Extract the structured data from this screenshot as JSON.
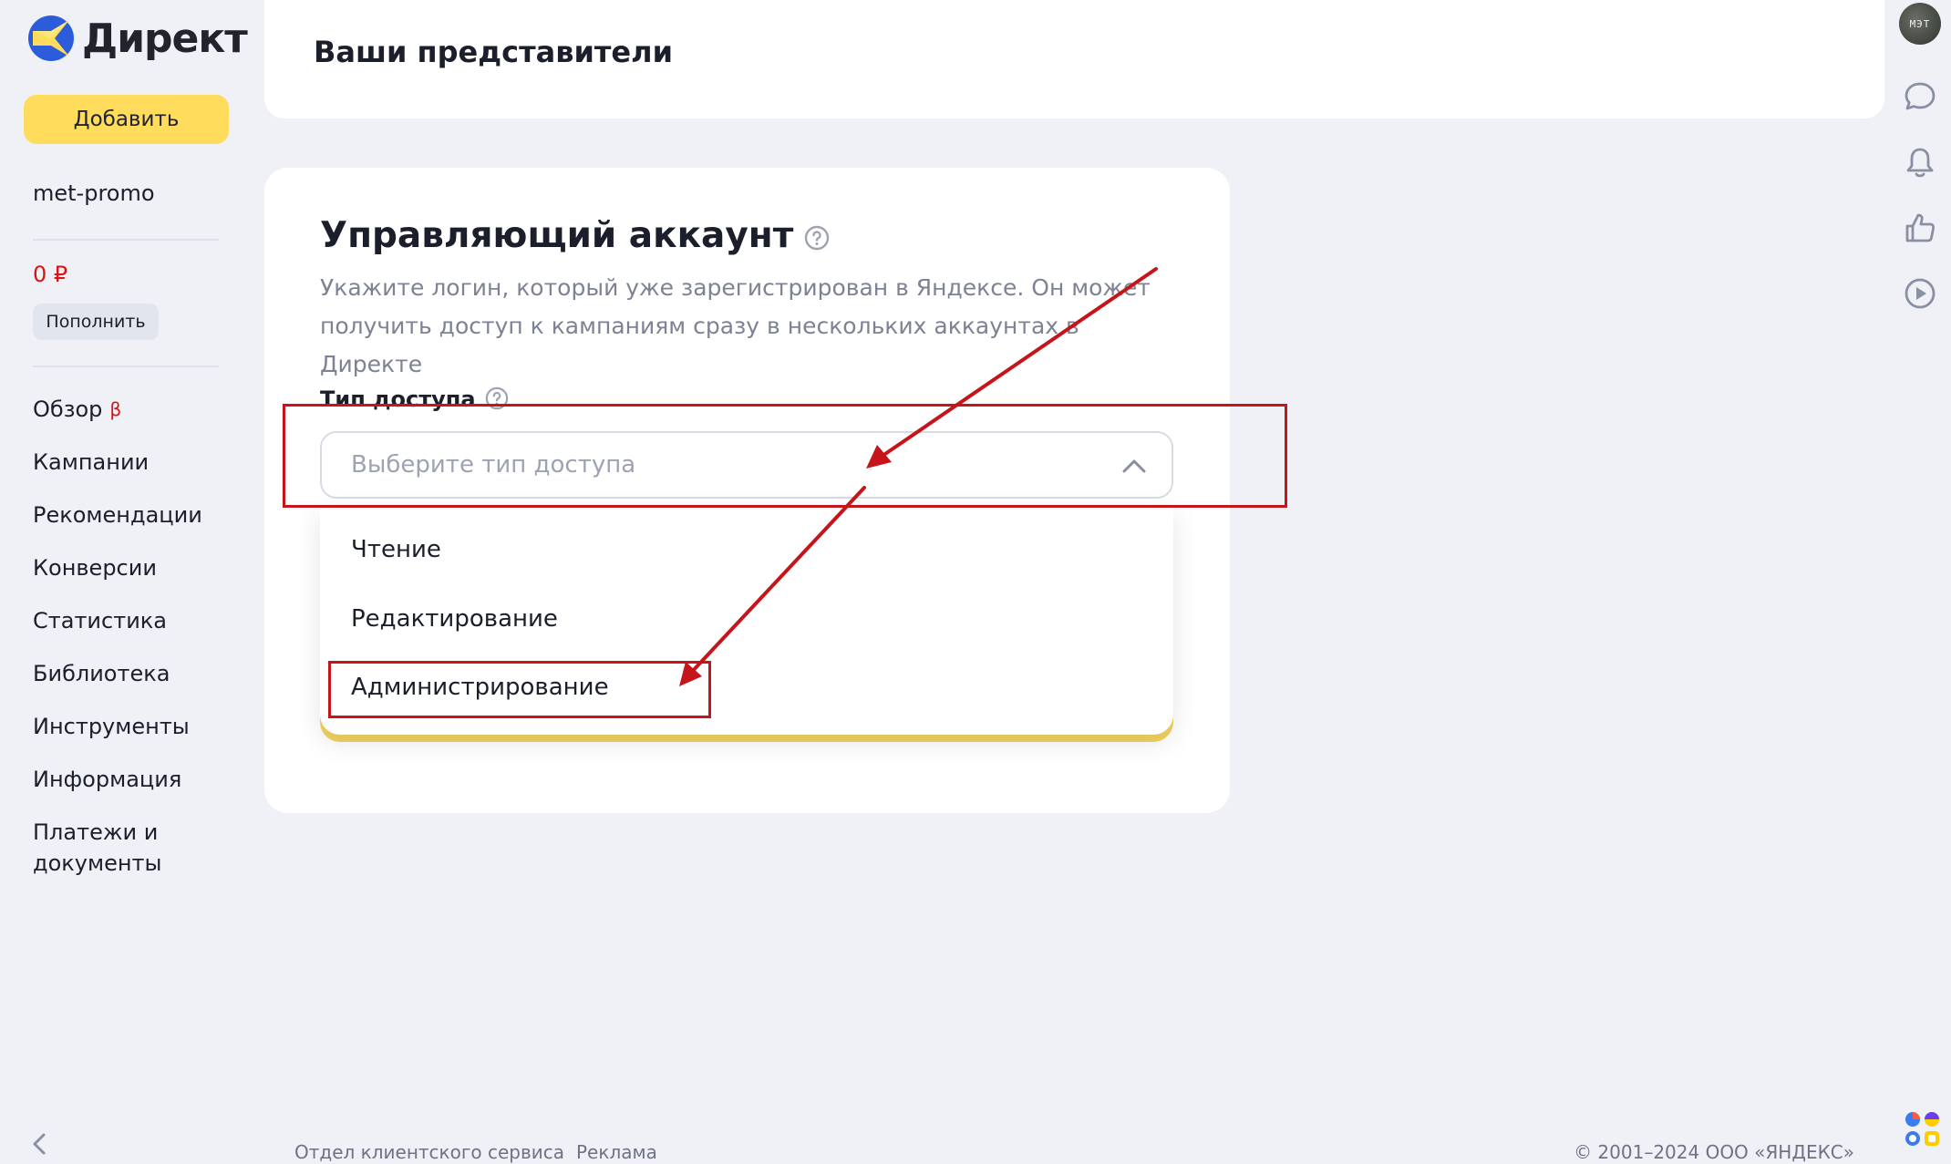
{
  "brand": {
    "logo_text": "Директ"
  },
  "sidebar": {
    "add_button": "Добавить",
    "account_login": "met-promo",
    "balance": "0 ₽",
    "topup_button": "Пополнить",
    "nav": [
      {
        "label": "Обзор",
        "badge": "β"
      },
      {
        "label": "Кампании"
      },
      {
        "label": "Рекомендации"
      },
      {
        "label": "Конверсии"
      },
      {
        "label": "Статистика"
      },
      {
        "label": "Библиотека"
      },
      {
        "label": "Инструменты"
      },
      {
        "label": "Информация"
      },
      {
        "label": "Платежи и документы"
      }
    ]
  },
  "rail": {
    "avatar_text": "МЭТ"
  },
  "header": {
    "title": "Ваши представители"
  },
  "card": {
    "title": "Управляющий аккаунт",
    "description": "Укажите логин, который уже зарегистрирован в Яндексе. Он может получить доступ к кампаниям сразу в нескольких аккаунтах в Директе",
    "access_label": "Тип доступа",
    "select_placeholder": "Выберите тип доступа",
    "options": [
      "Чтение",
      "Редактирование",
      "Администрирование"
    ]
  },
  "footer": {
    "links": [
      "Отдел клиентского сервиса",
      "Реклама"
    ],
    "copyright": "© 2001–2024  ООО «ЯНДЕКС»"
  },
  "colors": {
    "accent_yellow": "#ffdc5c",
    "annotation_red": "#c5151b",
    "balance_red": "#d81414",
    "background": "#eff1f7"
  },
  "icons": [
    "direkt-logo-icon",
    "help-icon",
    "chevron-up-icon",
    "chat-icon",
    "bell-icon",
    "thumb-up-icon",
    "play-icon",
    "collapse-arrow-icon",
    "services-grid-icon"
  ]
}
